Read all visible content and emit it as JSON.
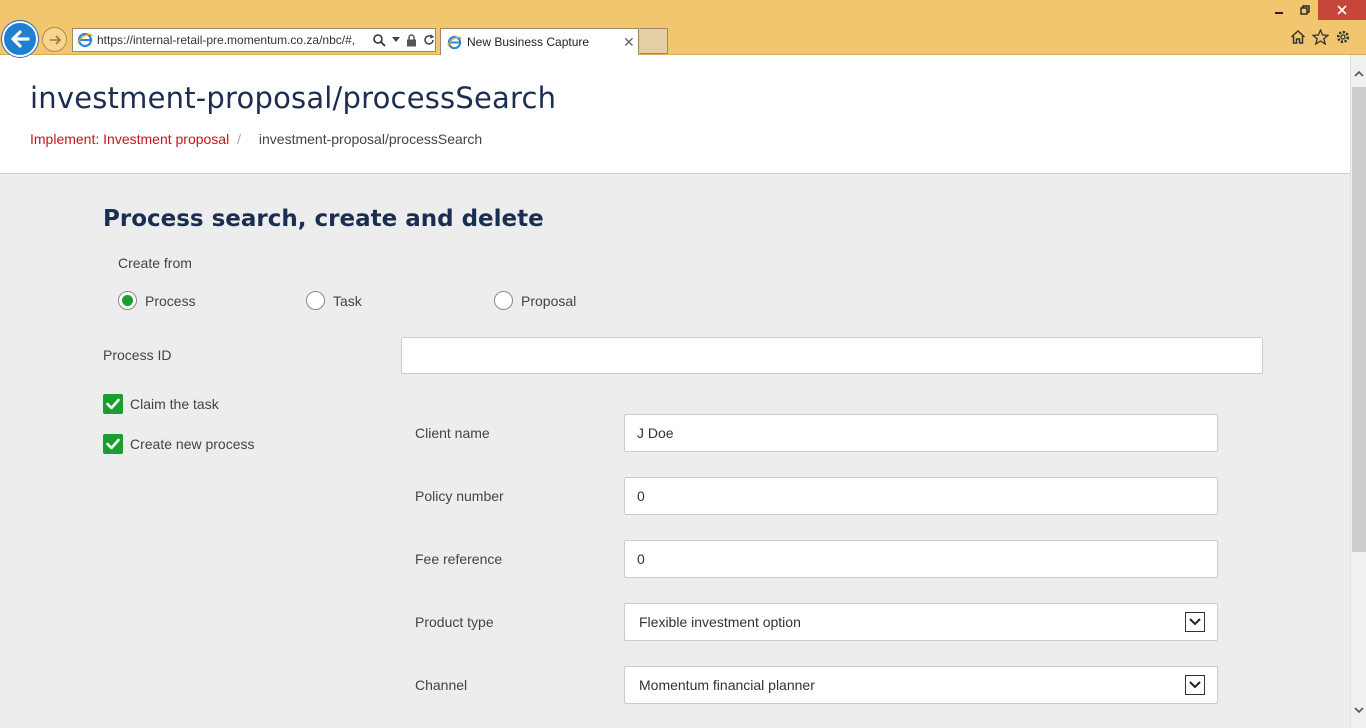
{
  "browser": {
    "url": "https://internal-retail-pre.momentum.co.za/nbc/#,",
    "tab_title": "New Business Capture",
    "colors": {
      "chrome": "#f2c66e",
      "back_button": "#1f7fd1",
      "close": "#c7463a"
    }
  },
  "page": {
    "title": "investment-proposal/processSearch",
    "breadcrumb": {
      "link": "Implement: Investment proposal",
      "separator": "/",
      "current": "investment-proposal/processSearch"
    }
  },
  "section": {
    "title": "Process search, create and delete",
    "create_from_label": "Create from",
    "radios": [
      {
        "label": "Process",
        "selected": true
      },
      {
        "label": "Task",
        "selected": false
      },
      {
        "label": "Proposal",
        "selected": false
      }
    ],
    "process_id_label": "Process ID",
    "process_id_value": "",
    "checkboxes": [
      {
        "label": "Claim the task",
        "checked": true
      },
      {
        "label": "Create new process",
        "checked": true
      }
    ],
    "fields": {
      "client_name": {
        "label": "Client name",
        "value": "J Doe"
      },
      "policy_number": {
        "label": "Policy number",
        "value": "0"
      },
      "fee_reference": {
        "label": "Fee reference",
        "value": "0"
      },
      "product_type": {
        "label": "Product type",
        "value": "Flexible investment option"
      },
      "channel": {
        "label": "Channel",
        "value": "Momentum financial planner"
      }
    }
  },
  "theme": {
    "accent_green": "#1a9e2e",
    "title_navy": "#1b2e52",
    "link_red": "#c4161c"
  }
}
